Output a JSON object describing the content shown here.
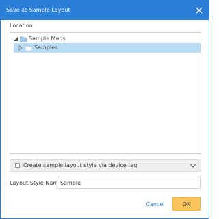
{
  "dialog": {
    "title": "Save as Sample Layout",
    "close_icon": "close-icon"
  },
  "location": {
    "label": "Location",
    "tree": {
      "root": {
        "label": "Sample Maps",
        "expanded": true,
        "icon": "folder-icon"
      },
      "children": [
        {
          "label": "Samples",
          "selected": true,
          "icon": "folder-icon"
        }
      ]
    }
  },
  "device_tag_option": {
    "label": "Create sample layout style via device tag",
    "checked": false,
    "expand_icon": "chevron-down-icon"
  },
  "layout_style_name": {
    "label": "Layout Style Name",
    "value": "Sample"
  },
  "buttons": {
    "cancel": "Cancel",
    "ok": "OK"
  },
  "colors": {
    "titlebar": "#2b7fd8",
    "selection": "#b9dcf6",
    "ok_button": "#fbc35d",
    "link": "#2b7fd8"
  }
}
